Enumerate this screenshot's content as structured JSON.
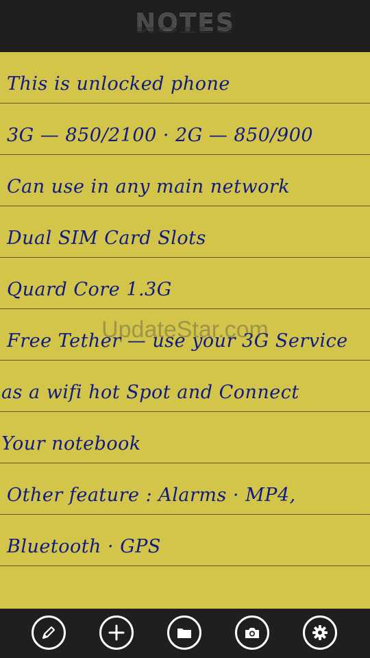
{
  "header": {
    "title": "NOTES"
  },
  "notes": {
    "lines": [
      "This is unlocked phone",
      "3G — 850/2100 · 2G — 850/900",
      "Can use in any main network",
      "Dual SIM Card Slots",
      "Quard Core 1.3G",
      "Free Tether — use your 3G Service",
      "as a wifi hot Spot and Connect",
      "Your notebook",
      "Other feature : Alarms · MP4,",
      "Bluetooth · GPS",
      ""
    ]
  },
  "watermark": {
    "text": "UpdateStar.com"
  },
  "appbar": {
    "buttons": [
      {
        "icon": "pencil-icon"
      },
      {
        "icon": "plus-icon"
      },
      {
        "icon": "folder-icon"
      },
      {
        "icon": "camera-icon"
      },
      {
        "icon": "gear-icon"
      }
    ]
  },
  "colors": {
    "paper": "#d3c549",
    "ink": "#0f1a86",
    "rule": "#5a5424",
    "bar": "#1f1f1f"
  }
}
